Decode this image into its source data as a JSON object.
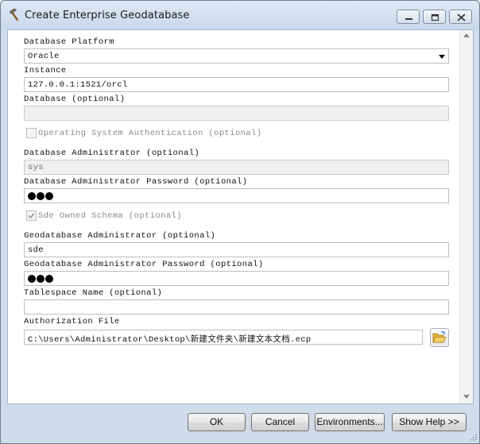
{
  "window": {
    "title": "Create Enterprise Geodatabase"
  },
  "form": {
    "platform_label": "Database Platform",
    "platform_value": "Oracle",
    "instance_label": "Instance",
    "instance_value": "127.0.0.1:1521/orcl",
    "database_label": "Database (optional)",
    "database_value": "",
    "os_auth_label": "Operating System Authentication (optional)",
    "os_auth_checked": false,
    "db_admin_label": "Database Administrator (optional)",
    "db_admin_value": "sys",
    "db_admin_password_label": "Database Administrator Password (optional)",
    "sde_schema_label": "Sde Owned Schema (optional)",
    "sde_schema_checked": true,
    "gdb_admin_label": "Geodatabase Administrator (optional)",
    "gdb_admin_value": "sde",
    "gdb_admin_password_label": "Geodatabase Administrator Password (optional)",
    "tablespace_label": "Tablespace Name (optional)",
    "tablespace_value": "",
    "auth_file_label": "Authorization File",
    "auth_file_value": "C:\\Users\\Administrator\\Desktop\\新建文件夹\\新建文本文档.ecp"
  },
  "buttons": {
    "ok": "OK",
    "cancel": "Cancel",
    "environments": "Environments...",
    "show_help": "Show Help >>"
  },
  "icons": {
    "title": "hammer-icon",
    "browse": "folder-open-icon"
  },
  "colors": {
    "titlebar": "#c8d8ea",
    "frame": "#cfdcea",
    "field_border": "#b9bfc8"
  }
}
